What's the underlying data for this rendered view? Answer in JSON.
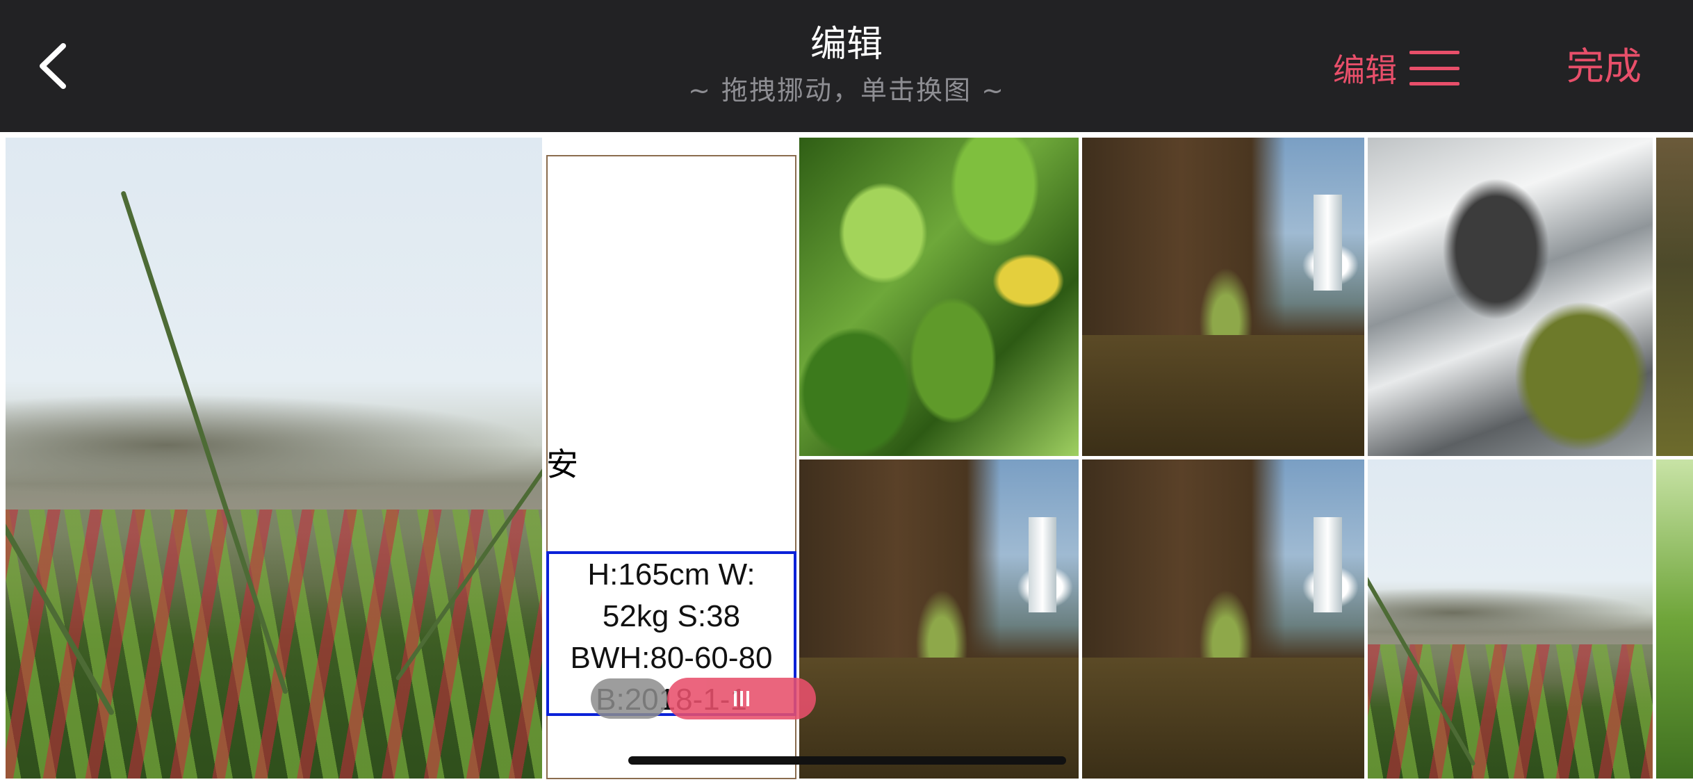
{
  "header": {
    "title": "编辑",
    "subtitle": "~ 拖拽挪动，单击换图 ~",
    "edit_label": "编辑",
    "done_label": "完成"
  },
  "icons": {
    "back": "chevron-left-icon",
    "menu": "hamburger-icon"
  },
  "colors": {
    "header_bg": "#222224",
    "accent": "#e84f6a",
    "subtitle": "#8e8e93",
    "info_border": "#0b22d8"
  },
  "grid": {
    "photos": [
      "beach-grass-photo",
      "green-leaves-photo",
      "waterfall-cliff-photo",
      "river-rapids-photo",
      "waterfall-cliff-photo-2",
      "waterfall-cliff-photo-3",
      "beach-grass-photo-2"
    ]
  },
  "card": {
    "char": "安",
    "info_lines": [
      "H:165cm W:",
      "52kg S:38",
      "BWH:80-60-80",
      "B:2018-1-1"
    ]
  }
}
